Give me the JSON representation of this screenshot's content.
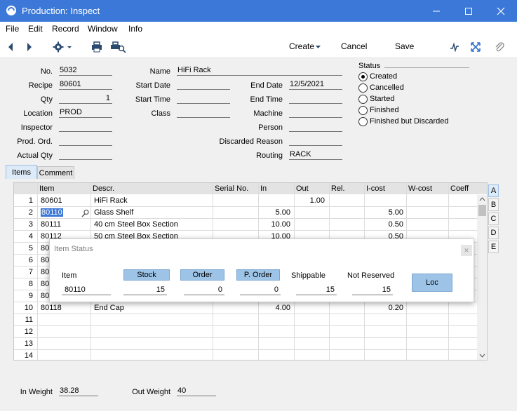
{
  "window": {
    "title": "Production: Inspect"
  },
  "menu": [
    "File",
    "Edit",
    "Record",
    "Window",
    "Info"
  ],
  "toolbar": {
    "create_label": "Create",
    "cancel_label": "Cancel",
    "save_label": "Save"
  },
  "header": {
    "no": {
      "label": "No.",
      "value": "5032"
    },
    "recipe": {
      "label": "Recipe",
      "value": "80601"
    },
    "qty": {
      "label": "Qty",
      "value": "1"
    },
    "location": {
      "label": "Location",
      "value": "PROD"
    },
    "inspector": {
      "label": "Inspector",
      "value": ""
    },
    "prod_ord": {
      "label": "Prod. Ord.",
      "value": ""
    },
    "actual_qty": {
      "label": "Actual Qty",
      "value": ""
    },
    "name": {
      "label": "Name",
      "value": "HiFi Rack"
    },
    "start_date": {
      "label": "Start Date",
      "value": ""
    },
    "start_time": {
      "label": "Start Time",
      "value": ""
    },
    "class": {
      "label": "Class",
      "value": ""
    },
    "end_date": {
      "label": "End Date",
      "value": "12/5/2021"
    },
    "end_time": {
      "label": "End Time",
      "value": ""
    },
    "machine": {
      "label": "Machine",
      "value": ""
    },
    "person": {
      "label": "Person",
      "value": ""
    },
    "discarded_reason": {
      "label": "Discarded Reason",
      "value": ""
    },
    "routing": {
      "label": "Routing",
      "value": "RACK"
    }
  },
  "status": {
    "label": "Status",
    "options": [
      "Created",
      "Cancelled",
      "Started",
      "Finished",
      "Finished but Discarded"
    ],
    "selected": "Created"
  },
  "tabs": {
    "items": "Items",
    "comment": "Comment"
  },
  "grid": {
    "columns": [
      "Item",
      "Descr.",
      "Serial No.",
      "In",
      "Out",
      "Rel.",
      "I-cost",
      "W-cost",
      "Coeff"
    ],
    "rows": [
      {
        "n": "1",
        "item": "80601",
        "descr": "HiFi Rack",
        "in": "",
        "out": "1.00",
        "icost": ""
      },
      {
        "n": "2",
        "item": "80110",
        "descr": "Glass Shelf",
        "in": "5.00",
        "out": "",
        "icost": "5.00"
      },
      {
        "n": "3",
        "item": "80111",
        "descr": "40 cm Steel Box Section",
        "in": "10.00",
        "out": "",
        "icost": "0.50"
      },
      {
        "n": "4",
        "item": "80112",
        "descr": "50 cm Steel Box Section",
        "in": "10.00",
        "out": "",
        "icost": "0.50"
      },
      {
        "n": "5",
        "item": "80",
        "descr": "",
        "in": "",
        "out": "",
        "icost": ""
      },
      {
        "n": "6",
        "item": "80",
        "descr": "",
        "in": "",
        "out": "",
        "icost": ""
      },
      {
        "n": "7",
        "item": "80",
        "descr": "",
        "in": "",
        "out": "",
        "icost": ""
      },
      {
        "n": "8",
        "item": "80",
        "descr": "",
        "in": "",
        "out": "",
        "icost": ""
      },
      {
        "n": "9",
        "item": "80",
        "descr": "",
        "in": "",
        "out": "",
        "icost": ""
      },
      {
        "n": "10",
        "item": "80118",
        "descr": "End Cap",
        "in": "4.00",
        "out": "",
        "icost": "0.20"
      },
      {
        "n": "11",
        "item": "",
        "descr": "",
        "in": "",
        "out": "",
        "icost": ""
      },
      {
        "n": "12",
        "item": "",
        "descr": "",
        "in": "",
        "out": "",
        "icost": ""
      },
      {
        "n": "13",
        "item": "",
        "descr": "",
        "in": "",
        "out": "",
        "icost": ""
      },
      {
        "n": "14",
        "item": "",
        "descr": "",
        "in": "",
        "out": "",
        "icost": ""
      }
    ]
  },
  "side_tabs": [
    "A",
    "B",
    "C",
    "D",
    "E"
  ],
  "item_status": {
    "title": "Item Status",
    "item_label": "Item",
    "item_value": "80110",
    "stock_label": "Stock",
    "stock_value": "15",
    "order_label": "Order",
    "order_value": "0",
    "porder_label": "P. Order",
    "porder_value": "0",
    "shippable_label": "Shippable",
    "shippable_value": "15",
    "not_reserved_label": "Not Reserved",
    "not_reserved_value": "15",
    "loc_label": "Loc"
  },
  "footer": {
    "in_weight": {
      "label": "In Weight",
      "value": "38.28"
    },
    "out_weight": {
      "label": "Out Weight",
      "value": "40"
    }
  },
  "colors": {
    "titlebar": "#3b78d8",
    "accent_button": "#9dc3e6",
    "selection": "#3b78d8"
  }
}
